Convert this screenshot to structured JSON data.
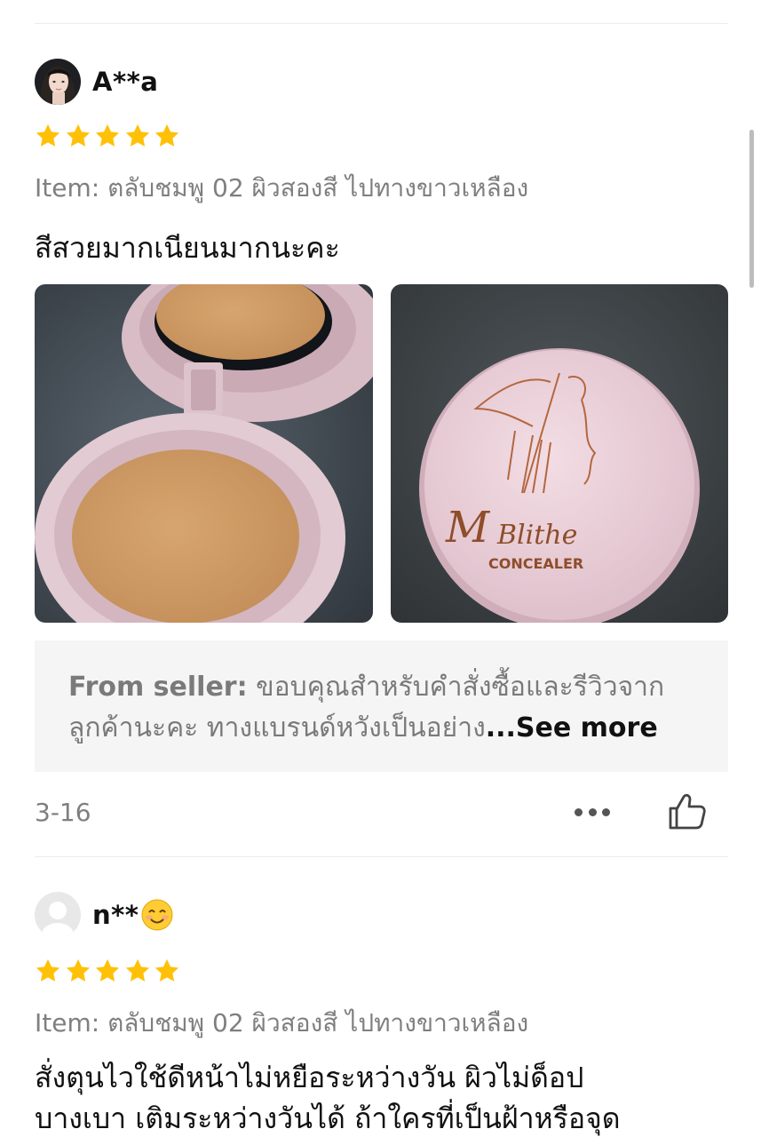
{
  "reviews": [
    {
      "username": "A**a",
      "rating": 5,
      "item": "Item: ตลับชมพู 02 ผิวสองสี ไปทางขาวเหลือง",
      "text": "สีสวยมากเนียนมากนะคะ",
      "photos": [
        "compact-open-photo",
        "compact-closed-photo"
      ],
      "seller_reply": {
        "prefix": "From seller:",
        "line1": " ขอบคุณสำหรับคำสั่งซื้อและรีวิวจาก",
        "line2": "ลูกค้านะคะ ทางแบรนด์หวังเป็นอย่าง",
        "see_more": "...See more"
      },
      "date": "3-16"
    },
    {
      "username": "n**",
      "rating": 5,
      "item": "Item: ตลับชมพู 02 ผิวสองสี ไปทางขาวเหลือง",
      "text_line1": "สั่งตุนไวใช้ดีหน้าไม่หยือระหว่างวัน ผิวไม่ด็อป",
      "text_line2": "บางเบา เติมระหว่างวันได้ ถ้าใครที่เป็นฝ้าหรือจุด"
    }
  ],
  "product_logo": {
    "brand": "MBlithe",
    "label": "CONCEALER"
  },
  "colors": {
    "star": "#FFC107",
    "seller_bg": "#F5F5F5",
    "muted_text": "#7F7F7F"
  },
  "icons": [
    "star-icon",
    "more-icon",
    "thumbs-up-icon",
    "smiley-emoji-icon",
    "default-avatar-icon"
  ]
}
